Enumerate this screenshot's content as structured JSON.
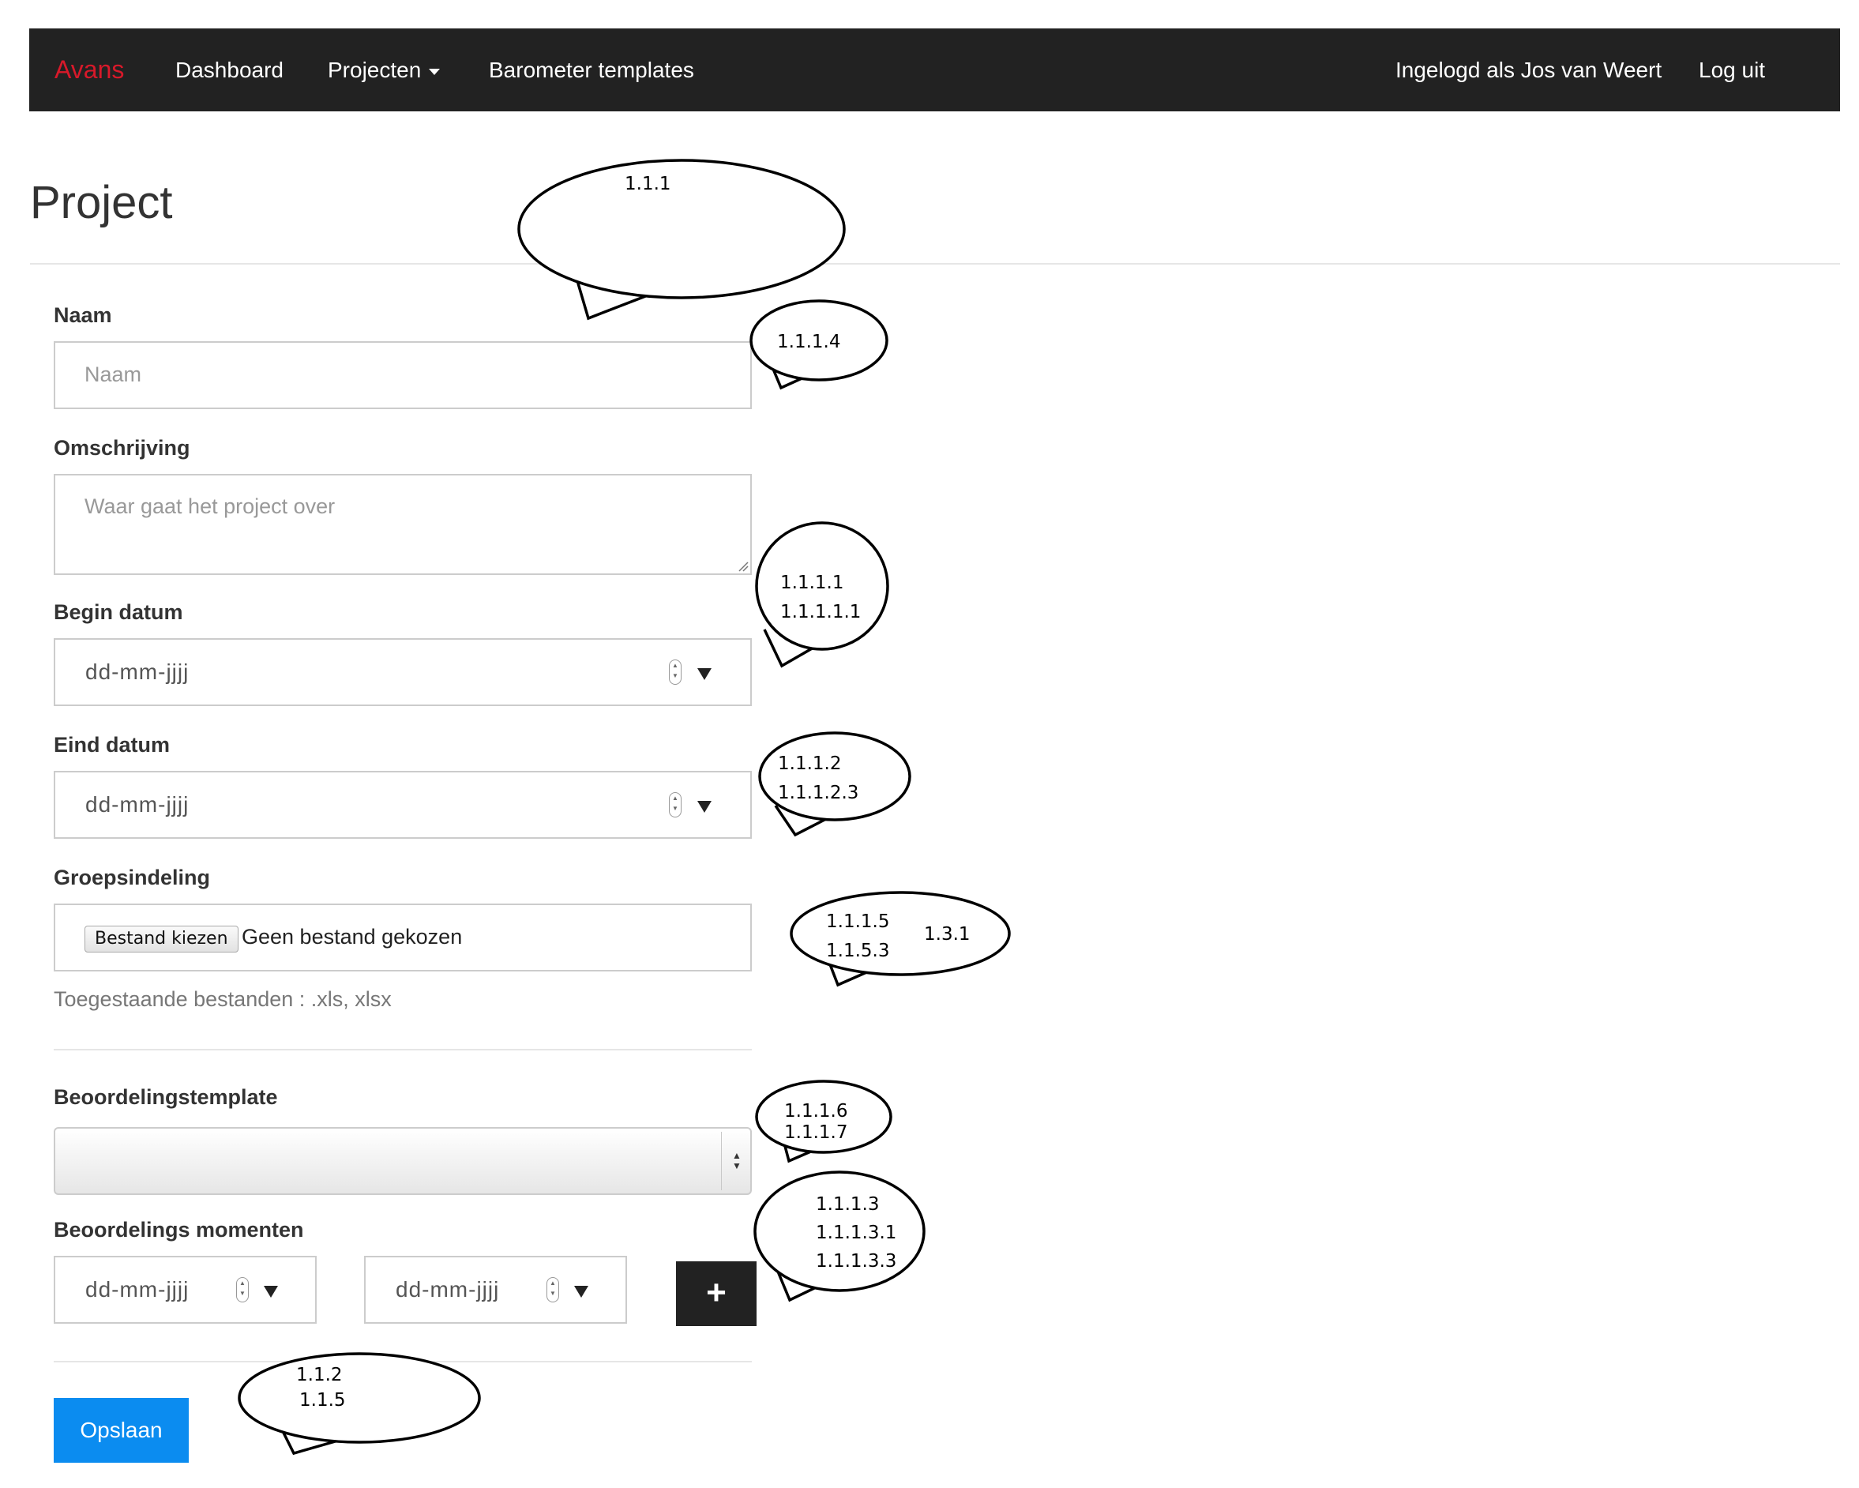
{
  "navbar": {
    "brand": "Avans",
    "items": [
      "Dashboard",
      "Projecten",
      "Barometer templates"
    ],
    "user": "Ingelogd als Jos van Weert",
    "logout": "Log uit"
  },
  "page": {
    "title": "Project"
  },
  "form": {
    "naam": {
      "label": "Naam",
      "placeholder": "Naam"
    },
    "omschrijving": {
      "label": "Omschrijving",
      "placeholder": "Waar gaat het project over"
    },
    "begin_datum": {
      "label": "Begin datum",
      "value": "dd-mm-jjjj"
    },
    "eind_datum": {
      "label": "Eind datum",
      "value": "dd-mm-jjjj"
    },
    "groepsindeling": {
      "label": "Groepsindeling",
      "button": "Bestand kiezen",
      "status": "Geen bestand gekozen",
      "help": "Toegestaande bestanden : .xls, xlsx"
    },
    "beoordelingstemplate": {
      "label": "Beoordelingstemplate",
      "value": ""
    },
    "beoordelingsmomenten": {
      "label": "Beoordelings momenten",
      "dates": [
        "dd-mm-jjjj",
        "dd-mm-jjjj"
      ],
      "add": "+"
    },
    "save": "Opslaan"
  },
  "callouts": [
    {
      "lines": [
        "1.1.1"
      ]
    },
    {
      "lines": [
        "1.1.1.4"
      ]
    },
    {
      "lines": [
        "1.1.1.1",
        "1.1.1.1.1"
      ]
    },
    {
      "lines": [
        "1.1.1.2",
        "1.1.1.2.3"
      ]
    },
    {
      "lines": [
        "1.1.1.5",
        "1.1.5.3",
        "1.3.1"
      ]
    },
    {
      "lines": [
        "1.1.1.6",
        "1.1.1.7"
      ]
    },
    {
      "lines": [
        "1.1.1.3",
        "1.1.1.3.1",
        "1.1.1.3.3"
      ]
    },
    {
      "lines": [
        "1.1.2",
        "1.1.5"
      ]
    }
  ]
}
